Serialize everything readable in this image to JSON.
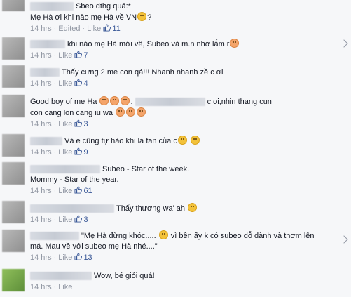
{
  "comments": [
    {
      "text": "Sbeo dthg quá:*",
      "text2": "Mẹ Hà ơi khi nào mẹ Hà về VN",
      "text2_end": "?",
      "time": "14 hrs",
      "edited": "Edited",
      "like_label": "Like",
      "likes": "11"
    },
    {
      "text": "khi nào mẹ Hà mới về, Subeo và m.n nhớ lắm r",
      "time": "14 hrs",
      "like_label": "Like",
      "likes": "7"
    },
    {
      "text": "Thấy cưng 2 me con qá!!! Nhanh nhanh zề c ơi",
      "time": "14 hrs",
      "like_label": "Like",
      "likes": "4"
    },
    {
      "text": "Good boy of me Ha",
      "text_b": "c oi,nhin thang cun",
      "text2": "con cang lon cang iu wa",
      "time": "14 hrs",
      "like_label": "Like",
      "likes": "3"
    },
    {
      "text": "Và e cũng tự hào khi là fan của c",
      "time": "14 hrs",
      "like_label": "Like",
      "likes": "9"
    },
    {
      "text": "Subeo - Star of the week.",
      "text2": "Mommy - Star of the year.",
      "time": "14 hrs",
      "like_label": "Like",
      "likes": "61"
    },
    {
      "text": "Thấy thương wa' ah",
      "time": "14 hrs",
      "like_label": "Like",
      "likes": "3"
    },
    {
      "text": "\"Mẹ Hà đừng khóc.....",
      "text_b": "vì bên ấy k có subeo dỗ dành và thơm lên",
      "text2": "má. Mau về với subeo mẹ Hà nhé....\"",
      "time": "14 hrs",
      "like_label": "Like",
      "likes": "13"
    },
    {
      "text": "Wow, bé giỏi quá!",
      "time": "14 hrs",
      "like_label": "Like"
    }
  ]
}
